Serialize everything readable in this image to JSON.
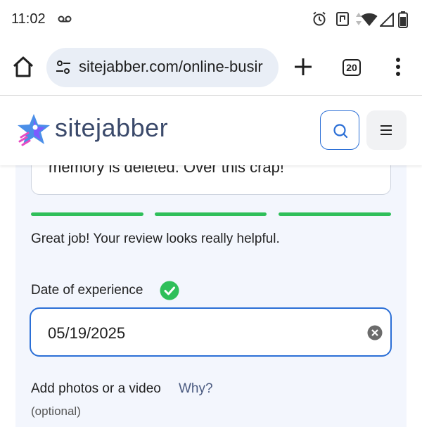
{
  "status_bar": {
    "time": "11:02",
    "icons": [
      "voicemail-icon",
      "alarm-icon",
      "nfc-icon",
      "wifi-icon",
      "signal-icon",
      "battery-icon"
    ]
  },
  "browser": {
    "url": "sitejabber.com/online-busir",
    "tab_count": "20",
    "icons": [
      "home-icon",
      "tune-icon",
      "plus-icon",
      "tabs-icon",
      "more-vert-icon"
    ]
  },
  "site_header": {
    "logo_text": "sitejabber",
    "icons": [
      "rocket-logo-icon",
      "search-icon",
      "hamburger-menu-icon"
    ]
  },
  "review_form": {
    "review_text_tail": "memory is deleted. Over this crap!",
    "progress_segments": 3,
    "progress_color": "#2fbf5a",
    "helpful_message": "Great job! Your review looks really helpful.",
    "date_label": "Date of experience",
    "date_value": "05/19/2025",
    "photos_label": "Add photos or a video",
    "why_link": "Why?",
    "optional_text": "(optional)"
  },
  "colors": {
    "accent_blue": "#2b6fd6",
    "success_green": "#2fbf5a",
    "form_bg": "#f3f6fd",
    "brand_text": "#3b4a6b"
  }
}
